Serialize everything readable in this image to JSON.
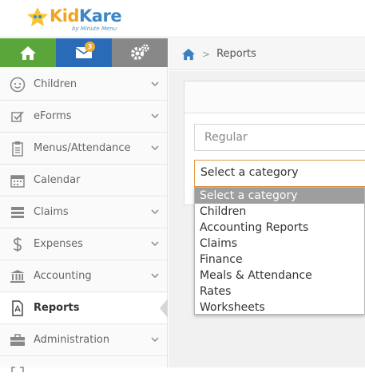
{
  "brand": {
    "logo_first": "Kid",
    "logo_second": "Kare",
    "logo_sub": "by Minute Menu"
  },
  "top_tabs": {
    "home_icon": "home-icon",
    "mail_icon": "envelope-icon",
    "mail_badge": "3",
    "settings_icon": "gears-icon",
    "colors": {
      "home": "#5aa63a",
      "mail": "#2a6bb8",
      "settings": "#888888",
      "badge": "#f0ad2e"
    }
  },
  "sidebar": {
    "items": [
      {
        "label": "Children",
        "icon": "child-face-icon",
        "has_chevron": true
      },
      {
        "label": "eForms",
        "icon": "checkbox-icon",
        "has_chevron": true
      },
      {
        "label": "Menus/Attendance",
        "icon": "clipboard-icon",
        "has_chevron": true
      },
      {
        "label": "Calendar",
        "icon": "calendar-icon",
        "has_chevron": false
      },
      {
        "label": "Claims",
        "icon": "claims-icon",
        "has_chevron": true
      },
      {
        "label": "Expenses",
        "icon": "dollar-icon",
        "has_chevron": true
      },
      {
        "label": "Accounting",
        "icon": "bank-icon",
        "has_chevron": true
      },
      {
        "label": "Reports",
        "icon": "pdf-document-icon",
        "has_chevron": false,
        "active": true
      },
      {
        "label": "Administration",
        "icon": "briefcase-icon",
        "has_chevron": true
      }
    ]
  },
  "breadcrumb": {
    "home_icon": "home-icon",
    "separator": ">",
    "current": "Reports"
  },
  "form": {
    "type_value": "Regular",
    "category_value": "Select a category",
    "category_options": [
      "Select a category",
      "Children",
      "Accounting Reports",
      "Claims",
      "Finance",
      "Meals & Attendance",
      "Rates",
      "Worksheets"
    ],
    "selected_index": 0,
    "focus_color": "#e39b46"
  }
}
